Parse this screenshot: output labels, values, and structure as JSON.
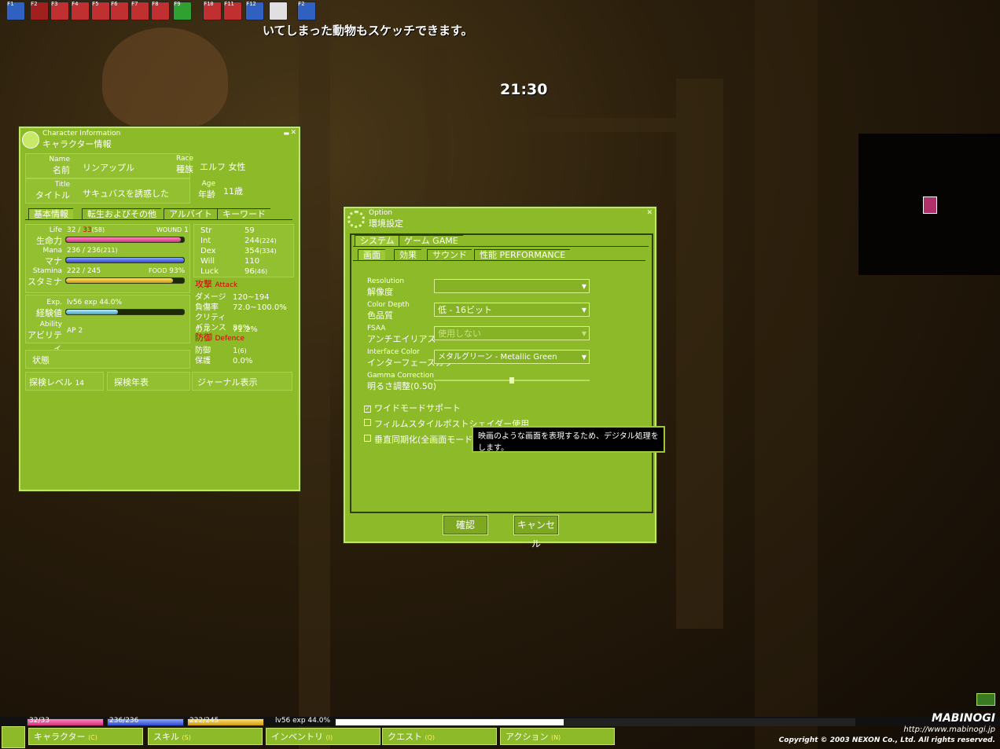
{
  "hud": {
    "notice": "いてしまった動物もスケッチできます。",
    "clock": "21:30",
    "hotbar_keys": [
      "F1",
      "F2",
      "F3",
      "F4",
      "F5",
      "F6",
      "F7",
      "F8",
      "F9",
      "F10",
      "F11",
      "F12",
      "",
      "F2"
    ]
  },
  "char_window": {
    "subtitle": "Character Information",
    "title": "キャラクター情報",
    "name_en": "Name",
    "name_jp": "名前",
    "name_value": "リンアップル",
    "race_en": "Race",
    "race_jp": "種族",
    "race_value": "エルフ 女性",
    "title_en": "Title",
    "title_jp": "タイトル",
    "title_value": "サキュバスを誘惑した",
    "age_en": "Age",
    "age_jp": "年齢",
    "age_value": "11歳",
    "tabs": [
      "基本情報",
      "転生およびその他",
      "アルバイト",
      "キーワード"
    ],
    "life_en": "Life",
    "life_jp": "生命力",
    "life_value": "32",
    "life_max": "33",
    "life_max_sub": "(58)",
    "wound_label": "WOUND",
    "wound_value": "1",
    "life_fraction": 0.97,
    "mana_en": "Mana",
    "mana_jp": "マナ",
    "mana_value": "236 / 236",
    "mana_sub": "(211)",
    "mana_fraction": 1.0,
    "stamina_en": "Stamina",
    "stamina_jp": "スタミナ",
    "stamina_value": "222 / 245",
    "food_label": "FOOD",
    "food_value": "93%",
    "stamina_fraction": 0.906,
    "exp_en": "Exp.",
    "exp_jp": "経験値",
    "exp_value": "lv56 exp 44.0%",
    "exp_fraction": 0.44,
    "ability_en": "Ability",
    "ability_jp": "アビリティ",
    "ability_value": "AP 2",
    "status_label": "状態",
    "explore_label": "探検レベル",
    "explore_value": "14",
    "explore_year_button": "探検年表",
    "journal_button": "ジャーナル表示",
    "stats": [
      {
        "label": "Str",
        "value": "59",
        "sub": ""
      },
      {
        "label": "Int",
        "value": "244",
        "sub": "(224)"
      },
      {
        "label": "Dex",
        "value": "354",
        "sub": "(334)"
      },
      {
        "label": "Will",
        "value": "110",
        "sub": ""
      },
      {
        "label": "Luck",
        "value": "96",
        "sub": "(46)"
      }
    ],
    "attack_jp": "攻撃",
    "attack_en": "Attack",
    "attack_rows": [
      {
        "label": "ダメージ",
        "value": "120~194"
      },
      {
        "label": "負傷率",
        "value": "72.0~100.0%"
      },
      {
        "label": "クリティカル",
        "value": "71.2%"
      },
      {
        "label": "バランス",
        "value": "80%"
      }
    ],
    "defence_jp": "防御",
    "defence_en": "Defence",
    "defence_rows": [
      {
        "label": "防御",
        "value": "1",
        "sub": "(6)"
      },
      {
        "label": "保護",
        "value": "0.0%",
        "sub": ""
      }
    ]
  },
  "option_window": {
    "subtitle": "Option",
    "title": "環境設定",
    "top_tabs": [
      "システム",
      "ゲーム GAME"
    ],
    "sub_tabs": [
      "画面",
      "効果",
      "サウンド",
      "性能 PERFORMANCE"
    ],
    "resolution_en": "Resolution",
    "resolution_jp": "解像度",
    "resolution_value": "",
    "color_en": "Color Depth",
    "color_jp": "色品質",
    "color_value": "低 - 16ビット",
    "fsaa_en": "FSAA",
    "fsaa_jp": "アンチエイリアス",
    "fsaa_value": "使用しない",
    "iface_en": "Interface Color",
    "iface_jp": "インターフェースカラー",
    "iface_value": "メタルグリーン - Metallic Green",
    "gamma_en": "Gamma Correction",
    "gamma_jp": "明るさ調整(0.50)",
    "gamma_fraction": 0.5,
    "checkboxes": [
      {
        "label": "ワイドモードサポート",
        "checked": true
      },
      {
        "label": "フィルムスタイルポストシェイダー使用",
        "checked": false
      },
      {
        "label": "垂直同期化(全画面モード",
        "checked": false
      }
    ],
    "tooltip": "映画のような画面を表現するため、デジタル処理をします。",
    "ok_button": "確認",
    "cancel_button": "キャンセル"
  },
  "bottom_bar": {
    "life": "32/33",
    "mana": "236/236",
    "stamina": "222/245",
    "exp": "lv56 exp 44.0%",
    "exp_fraction": 0.44,
    "menu": [
      {
        "label": "キャラクター",
        "key": "(C)"
      },
      {
        "label": "スキル",
        "key": "(S)"
      },
      {
        "label": "インベントリ",
        "key": "(I)"
      },
      {
        "label": "クエスト",
        "key": "(Q)"
      },
      {
        "label": "アクション",
        "key": "(N)"
      }
    ],
    "logo": "MABINOGI",
    "url": "http://www.mabinogi.jp",
    "copyright": "Copyright © 2003 NEXON Co., Ltd. All rights reserved."
  }
}
